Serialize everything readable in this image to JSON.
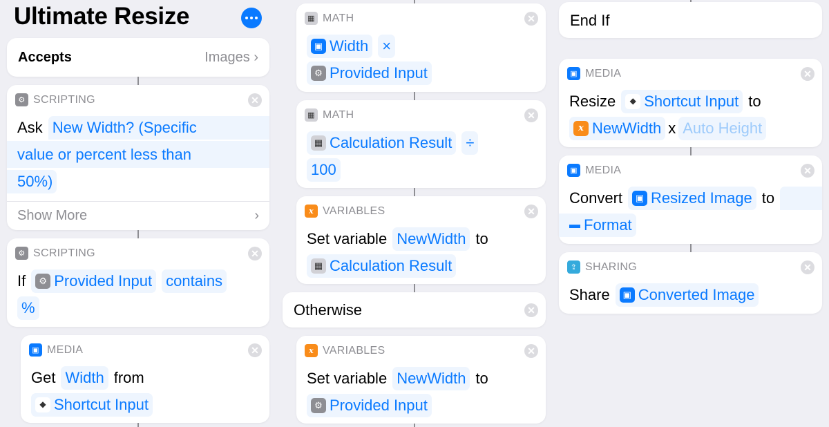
{
  "header": {
    "title": "Ultimate Resize",
    "more_icon": "ellipsis-icon"
  },
  "accepts": {
    "label": "Accepts",
    "value": "Images",
    "chevron": "›"
  },
  "actions": {
    "ask": {
      "category": "SCRIPTING",
      "verb": "Ask",
      "prompt_lines": [
        "New Width? (Specific",
        "value or percent less than",
        "50%)"
      ],
      "show_more": "Show More",
      "chevron": "›"
    },
    "if": {
      "category": "SCRIPTING",
      "verb": "If",
      "input": "Provided Input",
      "condition": "contains",
      "value": "%"
    },
    "get": {
      "category": "MEDIA",
      "verb": "Get",
      "property": "Width",
      "from": "from",
      "source": "Shortcut Input"
    },
    "math1": {
      "category": "MATH",
      "operand1": "Width",
      "operator": "×",
      "operand2": "Provided Input"
    },
    "math2": {
      "category": "MATH",
      "operand1": "Calculation Result",
      "operator": "÷",
      "operand2": "100"
    },
    "setvar1": {
      "category": "VARIABLES",
      "verb": "Set variable",
      "name": "NewWidth",
      "to": "to",
      "value": "Calculation Result"
    },
    "otherwise": {
      "label": "Otherwise"
    },
    "setvar2": {
      "category": "VARIABLES",
      "verb": "Set variable",
      "name": "NewWidth",
      "to": "to",
      "value": "Provided Input"
    },
    "endif": {
      "label": "End If"
    },
    "resize": {
      "category": "MEDIA",
      "verb": "Resize",
      "source": "Shortcut Input",
      "to": "to",
      "width": "NewWidth",
      "x": "x",
      "height": "Auto Height"
    },
    "convert": {
      "category": "MEDIA",
      "verb": "Convert",
      "source": "Resized Image",
      "to": "to",
      "format": "Format"
    },
    "share": {
      "category": "SHARING",
      "verb": "Share",
      "item": "Converted Image"
    }
  },
  "close_glyph": "✕",
  "colors": {
    "accent": "#0a7aff",
    "token_bg": "#eef5fe",
    "variables": "#f98c1a",
    "background": "#efeff4"
  }
}
